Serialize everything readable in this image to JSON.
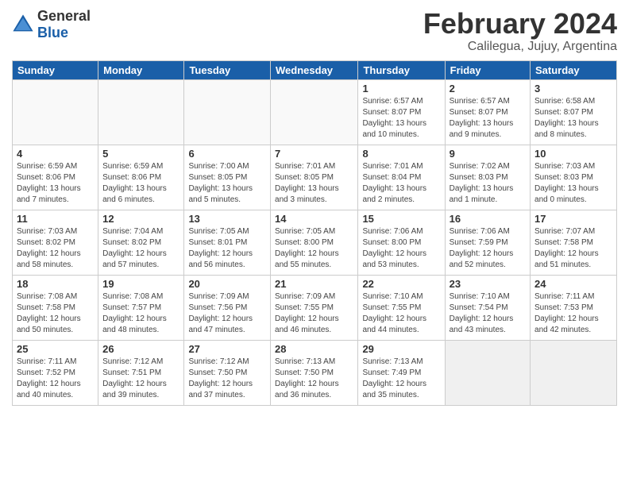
{
  "logo": {
    "general": "General",
    "blue": "Blue"
  },
  "header": {
    "month_title": "February 2024",
    "location": "Calilegua, Jujuy, Argentina"
  },
  "weekdays": [
    "Sunday",
    "Monday",
    "Tuesday",
    "Wednesday",
    "Thursday",
    "Friday",
    "Saturday"
  ],
  "weeks": [
    [
      {
        "day": "",
        "empty": true
      },
      {
        "day": "",
        "empty": true
      },
      {
        "day": "",
        "empty": true
      },
      {
        "day": "",
        "empty": true
      },
      {
        "day": "1",
        "info": "Sunrise: 6:57 AM\nSunset: 8:07 PM\nDaylight: 13 hours\nand 10 minutes."
      },
      {
        "day": "2",
        "info": "Sunrise: 6:57 AM\nSunset: 8:07 PM\nDaylight: 13 hours\nand 9 minutes."
      },
      {
        "day": "3",
        "info": "Sunrise: 6:58 AM\nSunset: 8:07 PM\nDaylight: 13 hours\nand 8 minutes."
      }
    ],
    [
      {
        "day": "4",
        "info": "Sunrise: 6:59 AM\nSunset: 8:06 PM\nDaylight: 13 hours\nand 7 minutes."
      },
      {
        "day": "5",
        "info": "Sunrise: 6:59 AM\nSunset: 8:06 PM\nDaylight: 13 hours\nand 6 minutes."
      },
      {
        "day": "6",
        "info": "Sunrise: 7:00 AM\nSunset: 8:05 PM\nDaylight: 13 hours\nand 5 minutes."
      },
      {
        "day": "7",
        "info": "Sunrise: 7:01 AM\nSunset: 8:05 PM\nDaylight: 13 hours\nand 3 minutes."
      },
      {
        "day": "8",
        "info": "Sunrise: 7:01 AM\nSunset: 8:04 PM\nDaylight: 13 hours\nand 2 minutes."
      },
      {
        "day": "9",
        "info": "Sunrise: 7:02 AM\nSunset: 8:03 PM\nDaylight: 13 hours\nand 1 minute."
      },
      {
        "day": "10",
        "info": "Sunrise: 7:03 AM\nSunset: 8:03 PM\nDaylight: 13 hours\nand 0 minutes."
      }
    ],
    [
      {
        "day": "11",
        "info": "Sunrise: 7:03 AM\nSunset: 8:02 PM\nDaylight: 12 hours\nand 58 minutes."
      },
      {
        "day": "12",
        "info": "Sunrise: 7:04 AM\nSunset: 8:02 PM\nDaylight: 12 hours\nand 57 minutes."
      },
      {
        "day": "13",
        "info": "Sunrise: 7:05 AM\nSunset: 8:01 PM\nDaylight: 12 hours\nand 56 minutes."
      },
      {
        "day": "14",
        "info": "Sunrise: 7:05 AM\nSunset: 8:00 PM\nDaylight: 12 hours\nand 55 minutes."
      },
      {
        "day": "15",
        "info": "Sunrise: 7:06 AM\nSunset: 8:00 PM\nDaylight: 12 hours\nand 53 minutes."
      },
      {
        "day": "16",
        "info": "Sunrise: 7:06 AM\nSunset: 7:59 PM\nDaylight: 12 hours\nand 52 minutes."
      },
      {
        "day": "17",
        "info": "Sunrise: 7:07 AM\nSunset: 7:58 PM\nDaylight: 12 hours\nand 51 minutes."
      }
    ],
    [
      {
        "day": "18",
        "info": "Sunrise: 7:08 AM\nSunset: 7:58 PM\nDaylight: 12 hours\nand 50 minutes."
      },
      {
        "day": "19",
        "info": "Sunrise: 7:08 AM\nSunset: 7:57 PM\nDaylight: 12 hours\nand 48 minutes."
      },
      {
        "day": "20",
        "info": "Sunrise: 7:09 AM\nSunset: 7:56 PM\nDaylight: 12 hours\nand 47 minutes."
      },
      {
        "day": "21",
        "info": "Sunrise: 7:09 AM\nSunset: 7:55 PM\nDaylight: 12 hours\nand 46 minutes."
      },
      {
        "day": "22",
        "info": "Sunrise: 7:10 AM\nSunset: 7:55 PM\nDaylight: 12 hours\nand 44 minutes."
      },
      {
        "day": "23",
        "info": "Sunrise: 7:10 AM\nSunset: 7:54 PM\nDaylight: 12 hours\nand 43 minutes."
      },
      {
        "day": "24",
        "info": "Sunrise: 7:11 AM\nSunset: 7:53 PM\nDaylight: 12 hours\nand 42 minutes."
      }
    ],
    [
      {
        "day": "25",
        "info": "Sunrise: 7:11 AM\nSunset: 7:52 PM\nDaylight: 12 hours\nand 40 minutes."
      },
      {
        "day": "26",
        "info": "Sunrise: 7:12 AM\nSunset: 7:51 PM\nDaylight: 12 hours\nand 39 minutes."
      },
      {
        "day": "27",
        "info": "Sunrise: 7:12 AM\nSunset: 7:50 PM\nDaylight: 12 hours\nand 37 minutes."
      },
      {
        "day": "28",
        "info": "Sunrise: 7:13 AM\nSunset: 7:50 PM\nDaylight: 12 hours\nand 36 minutes."
      },
      {
        "day": "29",
        "info": "Sunrise: 7:13 AM\nSunset: 7:49 PM\nDaylight: 12 hours\nand 35 minutes."
      },
      {
        "day": "",
        "empty": true,
        "shaded": true
      },
      {
        "day": "",
        "empty": true,
        "shaded": true
      }
    ]
  ]
}
